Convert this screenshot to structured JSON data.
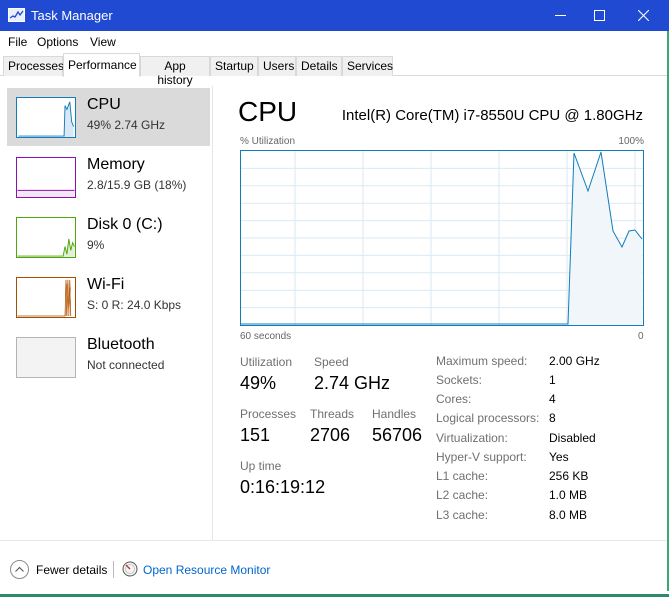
{
  "window": {
    "title": "Task Manager",
    "accent": "#1f4ad1",
    "icons": {
      "app": "task-manager-icon",
      "minimize": "minimize-icon",
      "maximize": "maximize-icon",
      "close": "close-icon"
    }
  },
  "menu": {
    "items": [
      "File",
      "Options",
      "View"
    ]
  },
  "tabs": {
    "items": [
      "Processes",
      "Performance",
      "App history",
      "Startup",
      "Users",
      "Details",
      "Services"
    ],
    "active": "Performance"
  },
  "sidebar": {
    "items": [
      {
        "name": "CPU",
        "sub": "49% 2.74 GHz",
        "color": "#117dbb",
        "selected": true
      },
      {
        "name": "Memory",
        "sub": "2.8/15.9 GB (18%)",
        "color": "#8b12ae"
      },
      {
        "name": "Disk 0 (C:)",
        "sub": "9%",
        "color": "#4da60c"
      },
      {
        "name": "Wi-Fi",
        "sub": "S: 0 R: 24.0 Kbps",
        "color": "#a74f01"
      },
      {
        "name": "Bluetooth",
        "sub": "Not connected",
        "color": "#b4b4b4"
      }
    ]
  },
  "main": {
    "title": "CPU",
    "model": "Intel(R) Core(TM) i7-8550U CPU @ 1.80GHz",
    "graph": {
      "y_label": "% Utilization",
      "y_max_label": "100%",
      "x_left_label": "60 seconds",
      "x_right_label": "0",
      "line_color": "#117dbb",
      "fill_color": "#f1f6fa"
    },
    "stats": {
      "utilization_label": "Utilization",
      "utilization": "49%",
      "speed_label": "Speed",
      "speed": "2.74 GHz",
      "processes_label": "Processes",
      "processes": "151",
      "threads_label": "Threads",
      "threads": "2706",
      "handles_label": "Handles",
      "handles": "56706",
      "uptime_label": "Up time",
      "uptime": "0:16:19:12"
    },
    "specs": [
      {
        "label": "Maximum speed:",
        "value": "2.00 GHz"
      },
      {
        "label": "Sockets:",
        "value": "1"
      },
      {
        "label": "Cores:",
        "value": "4"
      },
      {
        "label": "Logical processors:",
        "value": "8"
      },
      {
        "label": "Virtualization:",
        "value": "Disabled"
      },
      {
        "label": "Hyper-V support:",
        "value": "Yes"
      },
      {
        "label": "L1 cache:",
        "value": "256 KB"
      },
      {
        "label": "L2 cache:",
        "value": "1.0 MB"
      },
      {
        "label": "L3 cache:",
        "value": "8.0 MB"
      }
    ]
  },
  "footer": {
    "fewer_details": "Fewer details",
    "resource_monitor": "Open Resource Monitor",
    "fewer_icon": "chevron-up-icon",
    "resmon_icon": "resource-monitor-icon"
  }
}
